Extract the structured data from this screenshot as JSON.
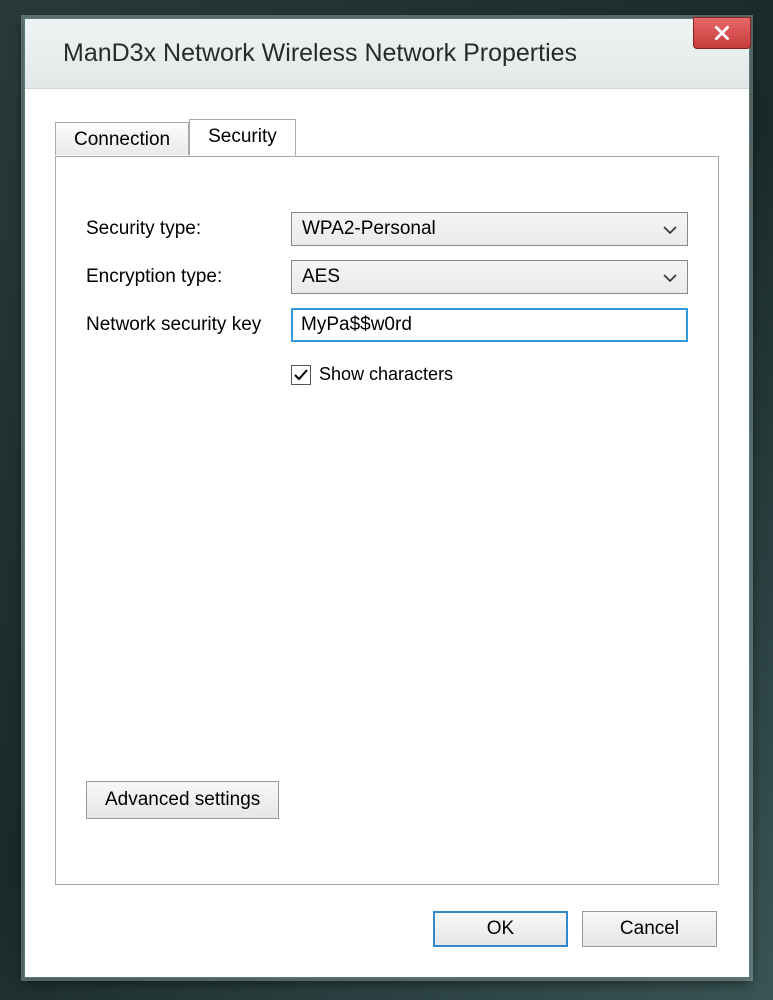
{
  "window": {
    "title": "ManD3x Network Wireless Network Properties"
  },
  "tabs": {
    "connection": "Connection",
    "security": "Security",
    "active": "security"
  },
  "form": {
    "security_type_label": "Security type:",
    "security_type_value": "WPA2-Personal",
    "encryption_type_label": "Encryption type:",
    "encryption_type_value": "AES",
    "network_key_label": "Network security key",
    "network_key_value": "MyPa$$w0rd",
    "show_characters_label": "Show characters",
    "show_characters_checked": true
  },
  "buttons": {
    "advanced": "Advanced settings",
    "ok": "OK",
    "cancel": "Cancel"
  }
}
